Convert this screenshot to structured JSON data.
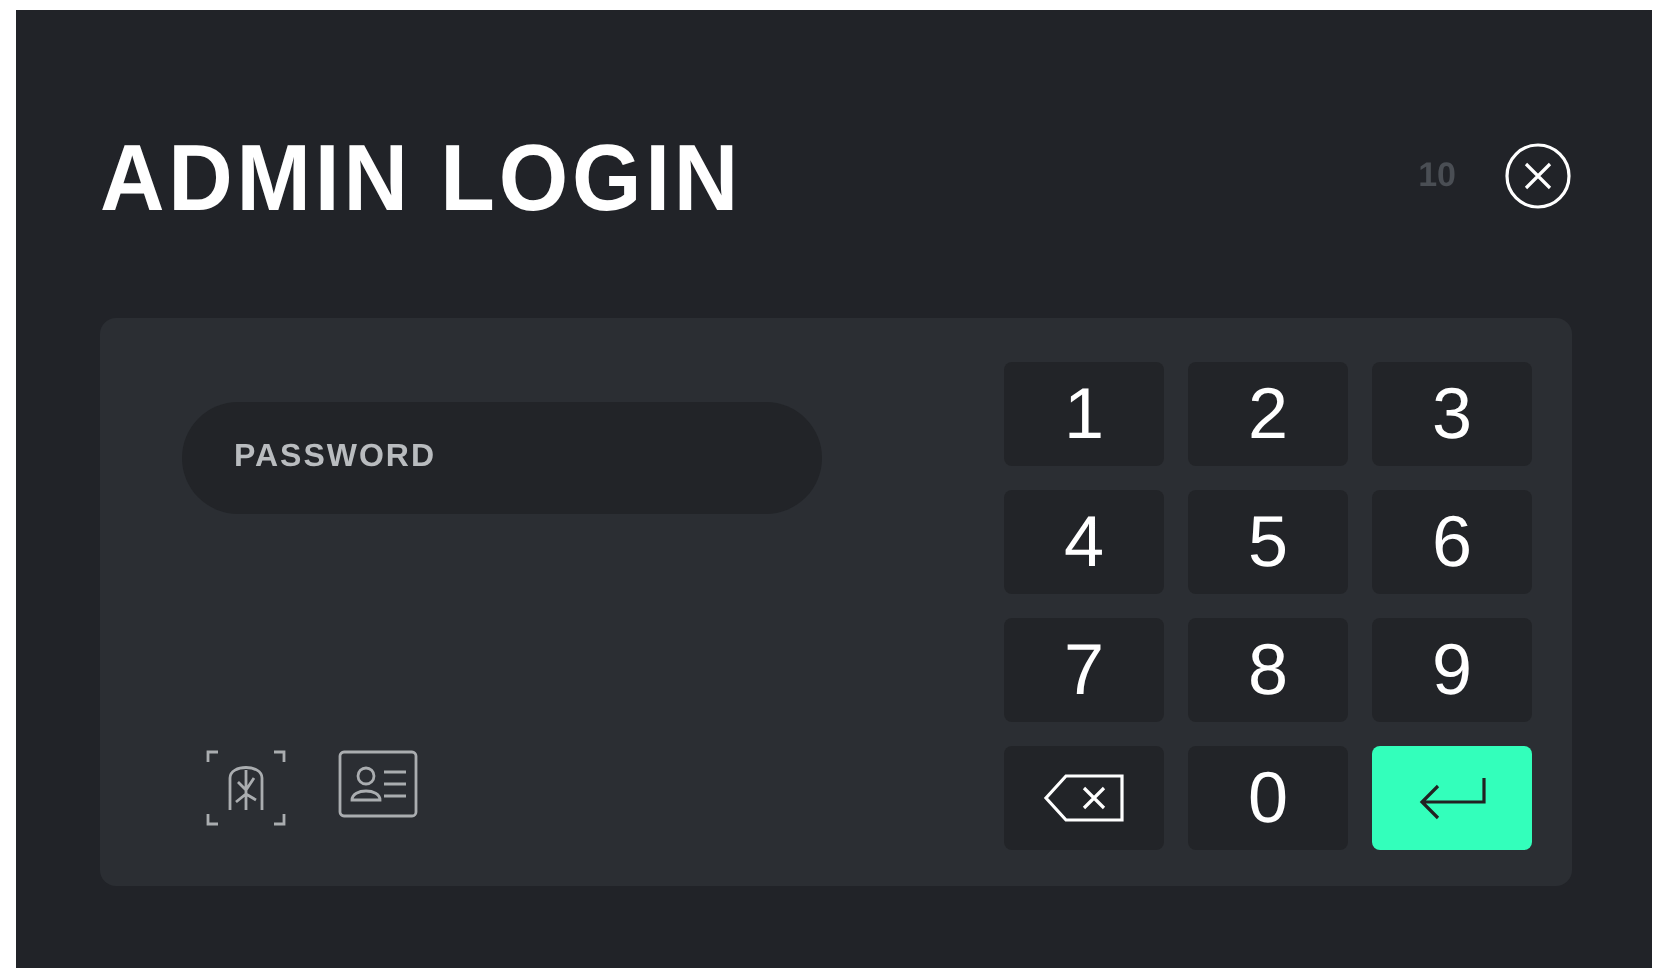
{
  "title": "ADMIN LOGIN",
  "countdown": "10",
  "password": {
    "placeholder": "PASSWORD"
  },
  "login_options": [
    {
      "kind": "face"
    },
    {
      "kind": "card"
    }
  ],
  "keypad": [
    {
      "kind": "digit",
      "label": "1"
    },
    {
      "kind": "digit",
      "label": "2"
    },
    {
      "kind": "digit",
      "label": "3"
    },
    {
      "kind": "digit",
      "label": "4"
    },
    {
      "kind": "digit",
      "label": "5"
    },
    {
      "kind": "digit",
      "label": "6"
    },
    {
      "kind": "digit",
      "label": "7"
    },
    {
      "kind": "digit",
      "label": "8"
    },
    {
      "kind": "digit",
      "label": "9"
    },
    {
      "kind": "backspace"
    },
    {
      "kind": "digit",
      "label": "0"
    },
    {
      "kind": "enter"
    }
  ]
}
